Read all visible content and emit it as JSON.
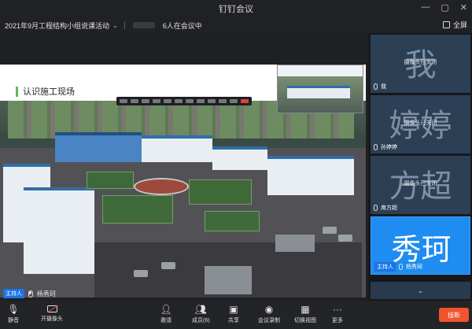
{
  "window": {
    "title": "钉钉会议",
    "minimize_glyph": "—",
    "restore_glyph": "▢",
    "close_glyph": "✕"
  },
  "infobar": {
    "meeting_title": "2021年9月工程结构小组说课活动",
    "participant_count": "6人在会议中",
    "fullscreen_label": "全屏"
  },
  "slide": {
    "heading": "认识施工现场"
  },
  "host": {
    "badge": "主持人",
    "name": "杨秀珂"
  },
  "participants": [
    {
      "avatar_text": "我",
      "status": "摄像头已关闭",
      "name": "我",
      "mic": "mic-icon"
    },
    {
      "avatar_text": "婷婷",
      "status": "摄像头已关闭",
      "name": "孙婷婷",
      "mic": "mic-icon"
    },
    {
      "avatar_text": "方超",
      "status": "摄像头已关闭",
      "name": "席方超",
      "mic": "mic-icon"
    },
    {
      "avatar_text": "秀珂",
      "badge": "主持人",
      "name": "杨秀珂",
      "mic": "mic-icon",
      "active": true
    }
  ],
  "panel_more": "⌄",
  "toolbar": {
    "mute": "静音",
    "camera": "开摄像头",
    "invite": "邀请",
    "members": "成员(6)",
    "share": "共享",
    "record": "会议录制",
    "switch_view": "切换视图",
    "more": "更多",
    "leave": "挂断"
  },
  "colors": {
    "accent": "#1a73e8",
    "active_tile": "#1e8cf0",
    "leave_button": "#f0532d",
    "heading_bar": "#5cb85c"
  }
}
